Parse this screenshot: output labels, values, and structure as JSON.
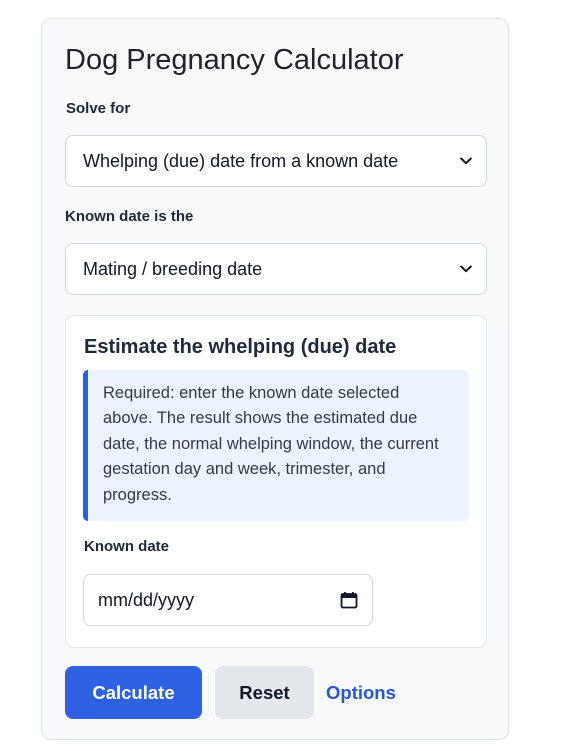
{
  "calculator": {
    "title": "Dog Pregnancy Calculator",
    "solve_for": {
      "label": "Solve for",
      "selected": "Whelping (due) date from a known date",
      "icon": "chevron-down-icon"
    },
    "known_date_type": {
      "label": "Known date is the",
      "selected": "Mating / breeding date",
      "icon": "chevron-down-icon"
    },
    "panel": {
      "title": "Estimate the whelping (due) date",
      "note": "Required: enter the known date selected above. The result shows the estimated due date, the normal whelping window, the current gestation day and week, trimester, and progress.",
      "date_field": {
        "label": "Known date",
        "placeholder": "mm/dd/yyyy",
        "icon": "calendar-icon"
      }
    },
    "actions": {
      "calculate": "Calculate",
      "reset": "Reset",
      "options": "Options"
    }
  },
  "colors": {
    "primary": "#2f62e3",
    "link": "#2b56d6",
    "note_accent": "#2c5fe0",
    "note_background": "#edf3fc",
    "secondary_button": "#e4e7ec"
  }
}
